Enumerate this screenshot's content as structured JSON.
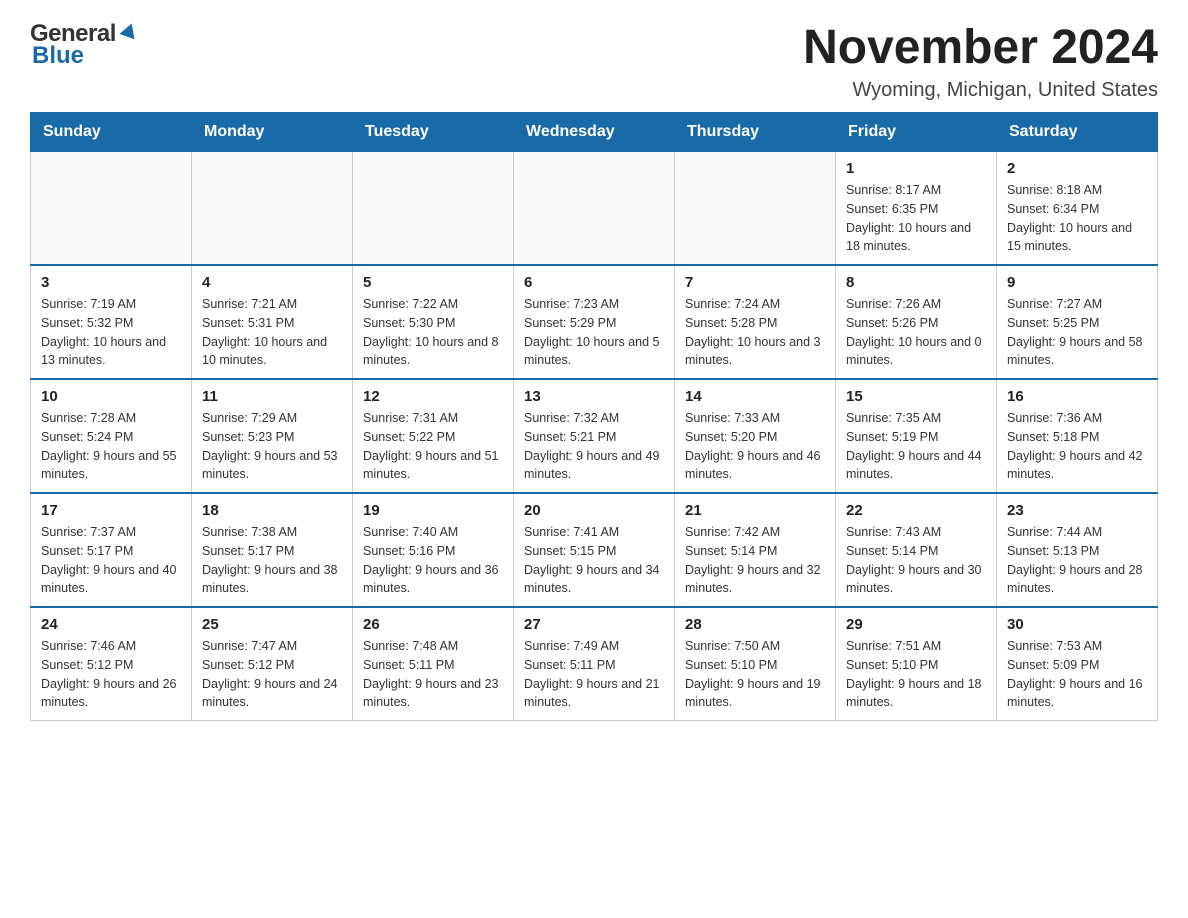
{
  "header": {
    "logo_general": "General",
    "logo_blue": "Blue",
    "title": "November 2024",
    "subtitle": "Wyoming, Michigan, United States"
  },
  "calendar": {
    "days": [
      "Sunday",
      "Monday",
      "Tuesday",
      "Wednesday",
      "Thursday",
      "Friday",
      "Saturday"
    ],
    "weeks": [
      [
        {
          "day": "",
          "info": ""
        },
        {
          "day": "",
          "info": ""
        },
        {
          "day": "",
          "info": ""
        },
        {
          "day": "",
          "info": ""
        },
        {
          "day": "",
          "info": ""
        },
        {
          "day": "1",
          "info": "Sunrise: 8:17 AM\nSunset: 6:35 PM\nDaylight: 10 hours\nand 18 minutes."
        },
        {
          "day": "2",
          "info": "Sunrise: 8:18 AM\nSunset: 6:34 PM\nDaylight: 10 hours\nand 15 minutes."
        }
      ],
      [
        {
          "day": "3",
          "info": "Sunrise: 7:19 AM\nSunset: 5:32 PM\nDaylight: 10 hours\nand 13 minutes."
        },
        {
          "day": "4",
          "info": "Sunrise: 7:21 AM\nSunset: 5:31 PM\nDaylight: 10 hours\nand 10 minutes."
        },
        {
          "day": "5",
          "info": "Sunrise: 7:22 AM\nSunset: 5:30 PM\nDaylight: 10 hours\nand 8 minutes."
        },
        {
          "day": "6",
          "info": "Sunrise: 7:23 AM\nSunset: 5:29 PM\nDaylight: 10 hours\nand 5 minutes."
        },
        {
          "day": "7",
          "info": "Sunrise: 7:24 AM\nSunset: 5:28 PM\nDaylight: 10 hours\nand 3 minutes."
        },
        {
          "day": "8",
          "info": "Sunrise: 7:26 AM\nSunset: 5:26 PM\nDaylight: 10 hours\nand 0 minutes."
        },
        {
          "day": "9",
          "info": "Sunrise: 7:27 AM\nSunset: 5:25 PM\nDaylight: 9 hours\nand 58 minutes."
        }
      ],
      [
        {
          "day": "10",
          "info": "Sunrise: 7:28 AM\nSunset: 5:24 PM\nDaylight: 9 hours\nand 55 minutes."
        },
        {
          "day": "11",
          "info": "Sunrise: 7:29 AM\nSunset: 5:23 PM\nDaylight: 9 hours\nand 53 minutes."
        },
        {
          "day": "12",
          "info": "Sunrise: 7:31 AM\nSunset: 5:22 PM\nDaylight: 9 hours\nand 51 minutes."
        },
        {
          "day": "13",
          "info": "Sunrise: 7:32 AM\nSunset: 5:21 PM\nDaylight: 9 hours\nand 49 minutes."
        },
        {
          "day": "14",
          "info": "Sunrise: 7:33 AM\nSunset: 5:20 PM\nDaylight: 9 hours\nand 46 minutes."
        },
        {
          "day": "15",
          "info": "Sunrise: 7:35 AM\nSunset: 5:19 PM\nDaylight: 9 hours\nand 44 minutes."
        },
        {
          "day": "16",
          "info": "Sunrise: 7:36 AM\nSunset: 5:18 PM\nDaylight: 9 hours\nand 42 minutes."
        }
      ],
      [
        {
          "day": "17",
          "info": "Sunrise: 7:37 AM\nSunset: 5:17 PM\nDaylight: 9 hours\nand 40 minutes."
        },
        {
          "day": "18",
          "info": "Sunrise: 7:38 AM\nSunset: 5:17 PM\nDaylight: 9 hours\nand 38 minutes."
        },
        {
          "day": "19",
          "info": "Sunrise: 7:40 AM\nSunset: 5:16 PM\nDaylight: 9 hours\nand 36 minutes."
        },
        {
          "day": "20",
          "info": "Sunrise: 7:41 AM\nSunset: 5:15 PM\nDaylight: 9 hours\nand 34 minutes."
        },
        {
          "day": "21",
          "info": "Sunrise: 7:42 AM\nSunset: 5:14 PM\nDaylight: 9 hours\nand 32 minutes."
        },
        {
          "day": "22",
          "info": "Sunrise: 7:43 AM\nSunset: 5:14 PM\nDaylight: 9 hours\nand 30 minutes."
        },
        {
          "day": "23",
          "info": "Sunrise: 7:44 AM\nSunset: 5:13 PM\nDaylight: 9 hours\nand 28 minutes."
        }
      ],
      [
        {
          "day": "24",
          "info": "Sunrise: 7:46 AM\nSunset: 5:12 PM\nDaylight: 9 hours\nand 26 minutes."
        },
        {
          "day": "25",
          "info": "Sunrise: 7:47 AM\nSunset: 5:12 PM\nDaylight: 9 hours\nand 24 minutes."
        },
        {
          "day": "26",
          "info": "Sunrise: 7:48 AM\nSunset: 5:11 PM\nDaylight: 9 hours\nand 23 minutes."
        },
        {
          "day": "27",
          "info": "Sunrise: 7:49 AM\nSunset: 5:11 PM\nDaylight: 9 hours\nand 21 minutes."
        },
        {
          "day": "28",
          "info": "Sunrise: 7:50 AM\nSunset: 5:10 PM\nDaylight: 9 hours\nand 19 minutes."
        },
        {
          "day": "29",
          "info": "Sunrise: 7:51 AM\nSunset: 5:10 PM\nDaylight: 9 hours\nand 18 minutes."
        },
        {
          "day": "30",
          "info": "Sunrise: 7:53 AM\nSunset: 5:09 PM\nDaylight: 9 hours\nand 16 minutes."
        }
      ]
    ]
  }
}
